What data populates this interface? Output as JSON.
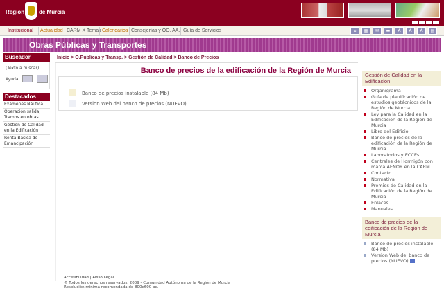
{
  "header": {
    "logo_left": "Región",
    "logo_right": "de Murcia"
  },
  "topnav": {
    "items": [
      "Institucional",
      "Actualidad",
      "CARM X Temas",
      "Calendarios",
      "Consejerías y OO. AA.",
      "Guía de Servicios"
    ]
  },
  "banner": {
    "title": "Obras Públicas y Transportes"
  },
  "sidebar": {
    "buscador_title": "Buscador",
    "search_placeholder": "(Texto a buscar)",
    "ayuda": "Ayuda",
    "destacados_title": "Destacados",
    "destacados": [
      "Exámenes Náutica",
      "Operación salida,\nTramos en obras",
      "Gestión de Calidad\nen la Edificación",
      "Renta Básica de\nEmancipación"
    ]
  },
  "breadcrumb": "Inicio > O.Públicas y Transp. > Gestión de Calidad > Banco de Precios",
  "page_title": "Banco de precios de la edificación de la Región de Murcia",
  "documents": [
    "Banco de precios instalable (84 Mb)",
    "Version Web del banco de precios (NUEVO)"
  ],
  "right": {
    "box1_title": "Gestión de Calidad en la Edificación",
    "box1_items": [
      "Organigrama",
      "Guía de planificación de estudios geotécnicos de la Región de Murcia",
      "Ley para la Calidad en la Edificación de la Región de Murcia",
      "Libro del Edificio",
      "Banco de precios de la edificación de la Región de Murcia",
      "Laboratorios y ECCEs",
      "Centrales de Hormigón con marca AENOR en la CARM",
      "Contacto",
      "Normativa",
      "Premios de Calidad en la Edificación de la Región de Murcia",
      "Enlaces",
      "Manuales"
    ],
    "box2_title": "Banco de precios de la edificación de la Región de Murcia",
    "box2_items": [
      "Banco de precios instalable (84 Mb)",
      "Version Web del banco de precios (NUEVO)"
    ]
  },
  "footer": {
    "links": "Accesibilidad | Aviso Legal",
    "line1": "© Todos los derechos reservados. 2009 - Comunidad Autónoma de la Región de Murcia",
    "line2": "Resolución mínima recomendada de 800x600 px."
  },
  "colors": {
    "brand_red": "#8b0020",
    "banner_purple": "#a03a8f",
    "title_red": "#8b0040"
  }
}
